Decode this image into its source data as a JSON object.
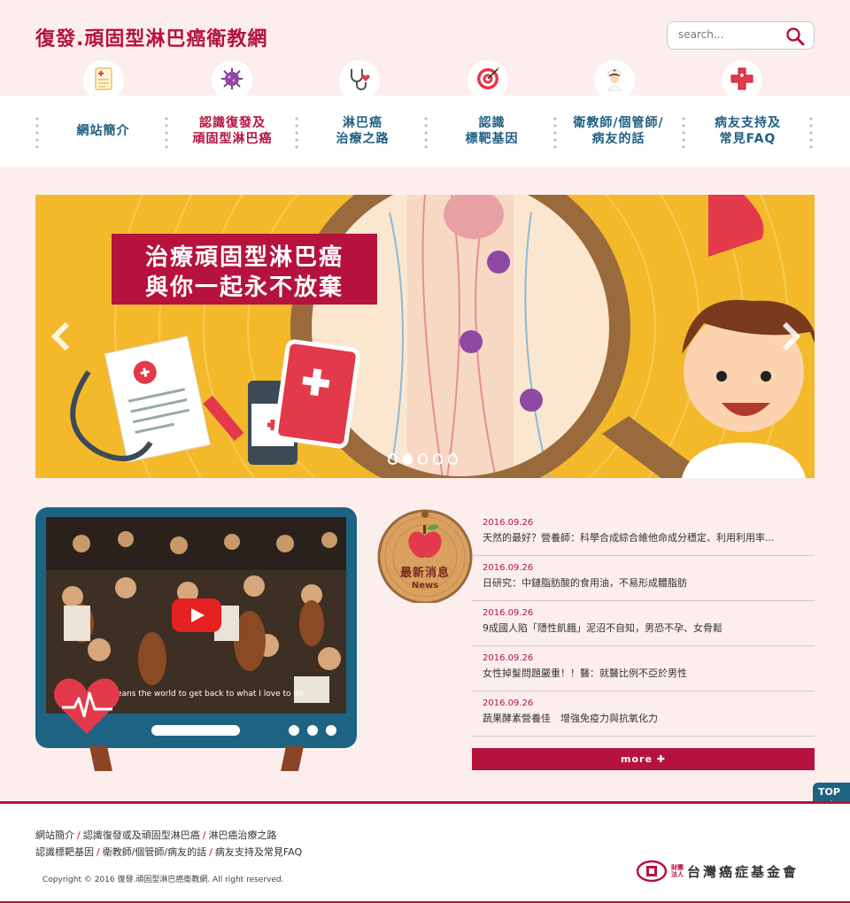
{
  "site": {
    "title": "復發.頑固型淋巴癌衛教網"
  },
  "search": {
    "placeholder": "search..."
  },
  "nav": {
    "items": [
      {
        "label": "網站簡介",
        "icon": "clipboard-icon"
      },
      {
        "label": "認識復發及\n頑固型淋巴癌",
        "icon": "virus-icon"
      },
      {
        "label": "淋巴癌\n治療之路",
        "icon": "stethoscope-icon"
      },
      {
        "label": "認識\n標靶基因",
        "icon": "target-icon"
      },
      {
        "label": "衛教師/個管師/\n病友的話",
        "icon": "nurse-icon"
      },
      {
        "label": "病友支持及\n常見FAQ",
        "icon": "medical-cross-icon"
      }
    ]
  },
  "banner": {
    "line1": "治療頑固型淋巴癌",
    "line2": "與你一起永不放棄",
    "slide_count": 5,
    "active_slide": 1
  },
  "video": {
    "caption": "eans the world to get back to what I love to do."
  },
  "news": {
    "badge_title": "最新消息",
    "badge_sub": "News",
    "items": [
      {
        "date": "2016.09.26",
        "text": "天然的最好？營養師：科學合成綜合維他命成分穩定、利用利用率..."
      },
      {
        "date": "2016.09.26",
        "text": "日研究：中鏈脂肪酸的食用油，不易形成體脂肪"
      },
      {
        "date": "2016.09.26",
        "text": "9成國人陷「隱性飢餓」泥沼不自知，男恐不孕、女骨鬆"
      },
      {
        "date": "2016.09.26",
        "text": "女性掉髮問題嚴重！！醫：就醫比例不亞於男性"
      },
      {
        "date": "2016.09.26",
        "text": "蔬果酵素營養佳　增強免疫力與抗氧化力"
      }
    ],
    "more_label": "more ✚"
  },
  "top_button": {
    "label": "TOP"
  },
  "footer": {
    "links": [
      "網站簡介",
      "認識復發或及頑固型淋巴癌",
      "淋巴癌治療之路",
      "認識標靶基因",
      "衛教師/個管師/病友的話",
      "病友支持及常見FAQ"
    ],
    "copyright": "Copyright © 2016 復發.頑固型淋巴癌衛教網. All right reserved.",
    "foundation_small_1": "財團",
    "foundation_small_2": "法人",
    "foundation_name": "台灣癌症基金會"
  },
  "colors": {
    "brand": "#b5123d",
    "nav_text": "#1f5f82",
    "banner": "#f3b92b",
    "background": "#fdeeee"
  }
}
